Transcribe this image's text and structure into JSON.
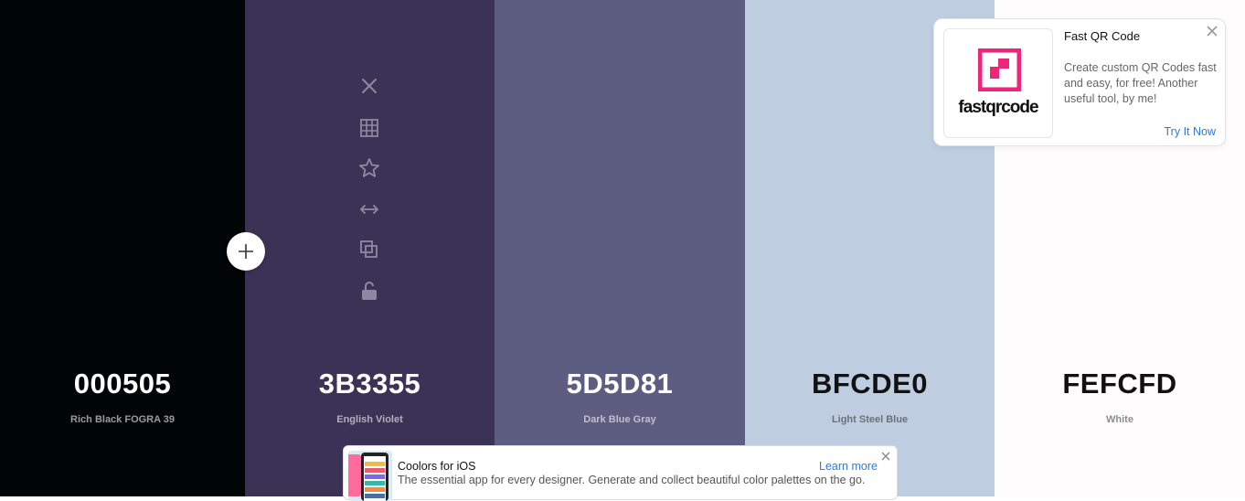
{
  "palette": {
    "colors": [
      {
        "hex": "000505",
        "name": "Rich Black FOGRA 39",
        "bg": "#000505"
      },
      {
        "hex": "3B3355",
        "name": "English Violet",
        "bg": "#3b3355"
      },
      {
        "hex": "5D5D81",
        "name": "Dark Blue Gray",
        "bg": "#5d5d81"
      },
      {
        "hex": "BFCDE0",
        "name": "Light Steel Blue",
        "bg": "#bfcde0"
      },
      {
        "hex": "FEFCFD",
        "name": "White",
        "bg": "#fefcfd"
      }
    ],
    "tool_icons": [
      "close-icon",
      "grid-icon",
      "star-icon",
      "arrows-horizontal-icon",
      "copy-icon",
      "unlock-icon"
    ],
    "add_icon": "plus-icon"
  },
  "ad_card": {
    "title": "Fast QR Code",
    "description": "Create custom QR Codes fast and easy, for free! Another useful tool, by me!",
    "cta": "Try It Now",
    "logo_text": "fastqrcode",
    "brand_color": "#f0247a",
    "link_color": "#2f7bd8"
  },
  "banner": {
    "title": "Coolors for iOS",
    "description": "The essential app for every designer. Generate and collect beautiful color palettes on the go.",
    "cta": "Learn more"
  }
}
